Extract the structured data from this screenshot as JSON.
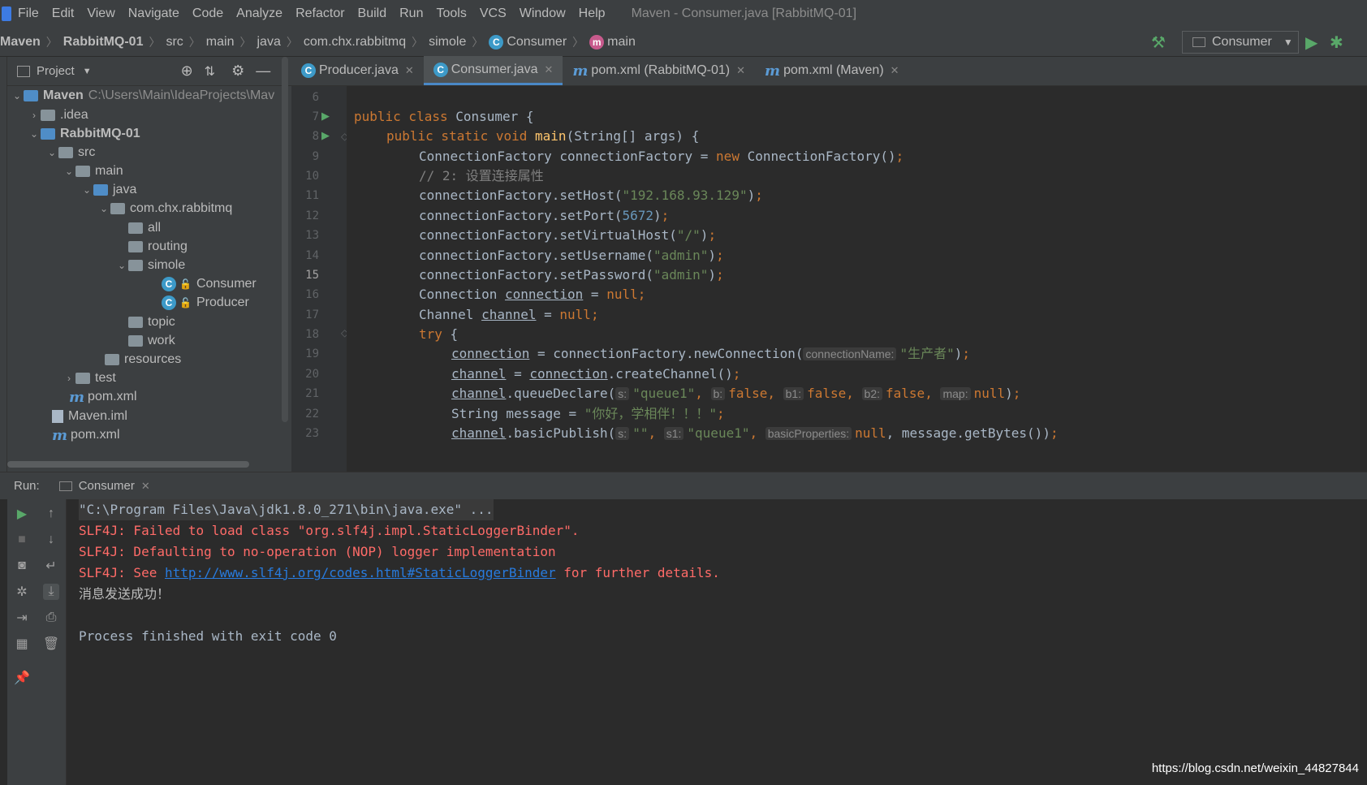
{
  "menu": [
    "File",
    "Edit",
    "View",
    "Navigate",
    "Code",
    "Analyze",
    "Refactor",
    "Build",
    "Run",
    "Tools",
    "VCS",
    "Window",
    "Help"
  ],
  "window_title": "Maven - Consumer.java [RabbitMQ-01]",
  "breadcrumbs": [
    "Maven",
    "RabbitMQ-01",
    "src",
    "main",
    "java",
    "com.chx.rabbitmq",
    "simole",
    "Consumer",
    "main"
  ],
  "run_config": "Consumer",
  "project_panel": {
    "title": "Project",
    "tree": [
      {
        "label": "Maven",
        "extra": "C:\\Users\\Main\\IdeaProjects\\Mav"
      },
      {
        "label": ".idea"
      },
      {
        "label": "RabbitMQ-01"
      },
      {
        "label": "src"
      },
      {
        "label": "main"
      },
      {
        "label": "java"
      },
      {
        "label": "com.chx.rabbitmq"
      },
      {
        "label": "all"
      },
      {
        "label": "routing"
      },
      {
        "label": "simole"
      },
      {
        "label": "Consumer"
      },
      {
        "label": "Producer"
      },
      {
        "label": "topic"
      },
      {
        "label": "work"
      },
      {
        "label": "resources"
      },
      {
        "label": "test"
      },
      {
        "label": "pom.xml"
      },
      {
        "label": "Maven.iml"
      },
      {
        "label": "pom.xml"
      }
    ]
  },
  "tabs": [
    "Producer.java",
    "Consumer.java",
    "pom.xml (RabbitMQ-01)",
    "pom.xml (Maven)"
  ],
  "line_numbers": [
    "6",
    "7",
    "8",
    "9",
    "10",
    "11",
    "12",
    "13",
    "14",
    "15",
    "16",
    "17",
    "18",
    "19",
    "20",
    "21",
    "22",
    "23"
  ],
  "code": {
    "l7_a": "public class ",
    "l7_b": "Consumer {",
    "l8_a": "public static void ",
    "l8_b": "main",
    "l8_c": "(String[] args) {",
    "l9_a": "ConnectionFactory connectionFactory = ",
    "l9_b": "new ",
    "l9_c": "ConnectionFactory()",
    "l9_d": ";",
    "l10": "// 2: 设置连接属性",
    "l11_a": "connectionFactory.setHost(",
    "l11_b": "\"192.168.93.129\"",
    "l11_c": ")",
    "l11_d": ";",
    "l12_a": "connectionFactory.setPort(",
    "l12_b": "5672",
    "l12_c": ")",
    "l12_d": ";",
    "l13_a": "connectionFactory.setVirtualHost(",
    "l13_b": "\"/\"",
    "l13_c": ")",
    "l13_d": ";",
    "l14_a": "connectionFactory.setUsername(",
    "l14_b": "\"admin\"",
    "l14_c": ")",
    "l14_d": ";",
    "l15_a": "connectionFactory.setPassword(",
    "l15_b": "\"admin\"",
    "l15_c": ")",
    "l15_d": ";",
    "l16_a": "Connection ",
    "l16_b": "connection",
    "l16_c": " = ",
    "l16_d": "null",
    "l16_e": ";",
    "l17_a": "Channel ",
    "l17_b": "channel",
    "l17_c": " = ",
    "l17_d": "null",
    "l17_e": ";",
    "l18_a": "try ",
    "l18_b": "{",
    "l19_a": "connection",
    "l19_b": " = connectionFactory.newConnection(",
    "l19_hint": "connectionName:",
    "l19_c": "\"生产者\"",
    "l19_d": ")",
    "l19_e": ";",
    "l20_a": "channel",
    "l20_b": " = ",
    "l20_c": "connection",
    "l20_d": ".createChannel()",
    "l20_e": ";",
    "l21_a": "channel",
    "l21_b": ".queueDeclare(",
    "l21_h1": "s:",
    "l21_c": "\"queue1\"",
    "l21_d": ", ",
    "l21_h2": "b:",
    "l21_e": "false",
    "l21_f": ", ",
    "l21_h3": "b1:",
    "l21_g": "false",
    "l21_i": ", ",
    "l21_h4": "b2:",
    "l21_j": "false",
    "l21_k": ", ",
    "l21_h5": "map:",
    "l21_l": "null",
    "l21_m": ")",
    "l21_n": ";",
    "l22_a": "String message = ",
    "l22_b": "\"你好，学相伴！！！\"",
    "l22_c": ";",
    "l23_a": "channel",
    "l23_b": ".basicPublish(",
    "l23_h1": "s:",
    "l23_c": "\"\"",
    "l23_d": ", ",
    "l23_h2": "s1:",
    "l23_e": "\"queue1\"",
    "l23_f": ", ",
    "l23_h3": "basicProperties:",
    "l23_g": "null",
    "l23_i": ", message.getBytes())",
    "l23_j": ";"
  },
  "run": {
    "label": "Run:",
    "tab": "Consumer",
    "console": {
      "cmd": "\"C:\\Program Files\\Java\\jdk1.8.0_271\\bin\\java.exe\" ...",
      "err1": "SLF4J: Failed to load class \"org.slf4j.impl.StaticLoggerBinder\".",
      "err2": "SLF4J: Defaulting to no-operation (NOP) logger implementation",
      "err3_a": "SLF4J: See ",
      "err3_link": "http://www.slf4j.org/codes.html#StaticLoggerBinder",
      "err3_b": " for further details.",
      "out1": "消息发送成功！",
      "out2": "Process finished with exit code 0"
    }
  },
  "watermark": "https://blog.csdn.net/weixin_44827844",
  "colors": {
    "keyword": "#cc7832",
    "string": "#6a8759",
    "number": "#6897bb",
    "error": "#ff6b68",
    "link": "#287bde"
  }
}
